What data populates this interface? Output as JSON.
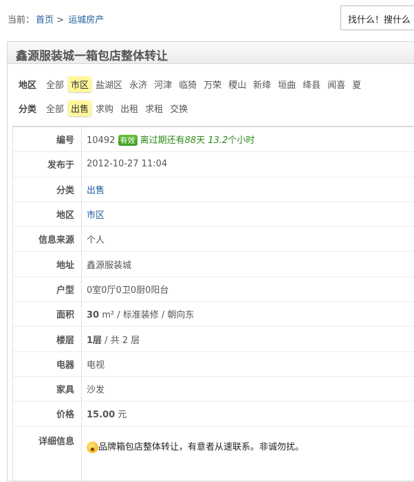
{
  "breadcrumb": {
    "prefix": "当前：",
    "home": "首页",
    "sep": ">",
    "current": "运城房产"
  },
  "search": {
    "text": "找什么！搜什么"
  },
  "listing": {
    "title": "鑫源服装城一箱包店整体转让"
  },
  "filters": {
    "region": {
      "label": "地区",
      "options": [
        "全部",
        "市区",
        "盐湖区",
        "永济",
        "河津",
        "临猗",
        "万荣",
        "稷山",
        "新绛",
        "垣曲",
        "绛县",
        "闻喜",
        "夏"
      ],
      "selected": "市区"
    },
    "category": {
      "label": "分类",
      "options": [
        "全部",
        "出售",
        "求购",
        "出租",
        "求租",
        "交换"
      ],
      "selected": "出售"
    }
  },
  "details": {
    "id_label": "编号",
    "id": "10492",
    "status": "有效",
    "expiry_pre": "离过期还有",
    "days": "88",
    "days_unit": "天",
    "hours": "13.2",
    "hours_unit": "个小时",
    "posted_label": "发布于",
    "posted": "2012-10-27 11:04",
    "category_label": "分类",
    "category": "出售",
    "region_label": "地区",
    "region": "市区",
    "source_label": "信息来源",
    "source": "个人",
    "address_label": "地址",
    "address": "鑫源服装城",
    "layout_label": "户型",
    "layout": "0室0厅0卫0厨0阳台",
    "area_label": "面积",
    "area": "30",
    "area_unit": "m²",
    "area_rest": " / 标准装修 / 朝向东",
    "floor_label": "楼层",
    "floor": "1层",
    "floor_rest": " / 共 2 层",
    "appliance_label": "电器",
    "appliance": "电视",
    "furniture_label": "家具",
    "furniture": "沙发",
    "price_label": "价格",
    "price": "15.00",
    "price_unit": "元",
    "info_label": "详细信息",
    "info": "品牌箱包店整体转让，有意者从速联系。非诚勿扰。",
    "info_icon": "emoji-surprised-icon"
  },
  "colors": {
    "link": "#1f5b9c",
    "highlight": "#fff79a",
    "valid": "#2a8a1a"
  }
}
